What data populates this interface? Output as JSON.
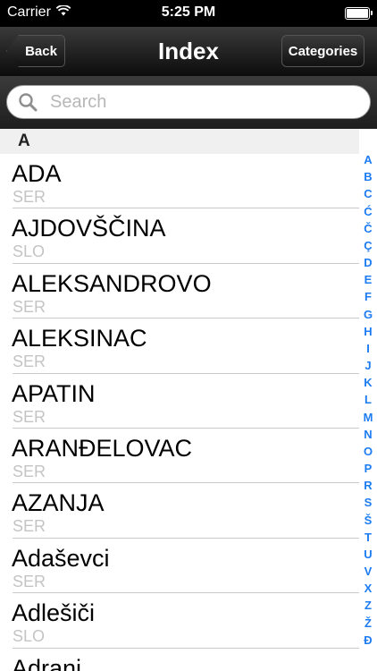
{
  "status": {
    "carrier": "Carrier",
    "time": "5:25 PM"
  },
  "nav": {
    "back_label": "Back",
    "title": "Index",
    "right_label": "Categories"
  },
  "search": {
    "placeholder": "Search"
  },
  "section": {
    "letter": "A"
  },
  "rows": [
    {
      "name": "ADA",
      "sub": "SER"
    },
    {
      "name": "AJDOVŠČINA",
      "sub": "SLO"
    },
    {
      "name": "ALEKSANDROVO",
      "sub": "SER"
    },
    {
      "name": "ALEKSINAC",
      "sub": "SER"
    },
    {
      "name": "APATIN",
      "sub": "SER"
    },
    {
      "name": "ARANĐELOVAC",
      "sub": "SER"
    },
    {
      "name": "AZANJA",
      "sub": "SER"
    },
    {
      "name": "Adaševci",
      "sub": "SER"
    },
    {
      "name": "Adlešiči",
      "sub": "SLO"
    },
    {
      "name": "Adrani",
      "sub": ""
    }
  ],
  "index_letters": [
    "A",
    "B",
    "C",
    "Ć",
    "Č",
    "Ç",
    "D",
    "E",
    "F",
    "G",
    "H",
    "I",
    "J",
    "K",
    "L",
    "M",
    "N",
    "O",
    "P",
    "R",
    "S",
    "Š",
    "T",
    "U",
    "V",
    "X",
    "Z",
    "Ž",
    "Đ"
  ],
  "colors": {
    "accent": "#1d7cf2",
    "nav_bg": "#1a1a1a"
  },
  "icons": {
    "search": "search-icon",
    "wifi": "wifi-icon",
    "battery": "battery-icon"
  }
}
